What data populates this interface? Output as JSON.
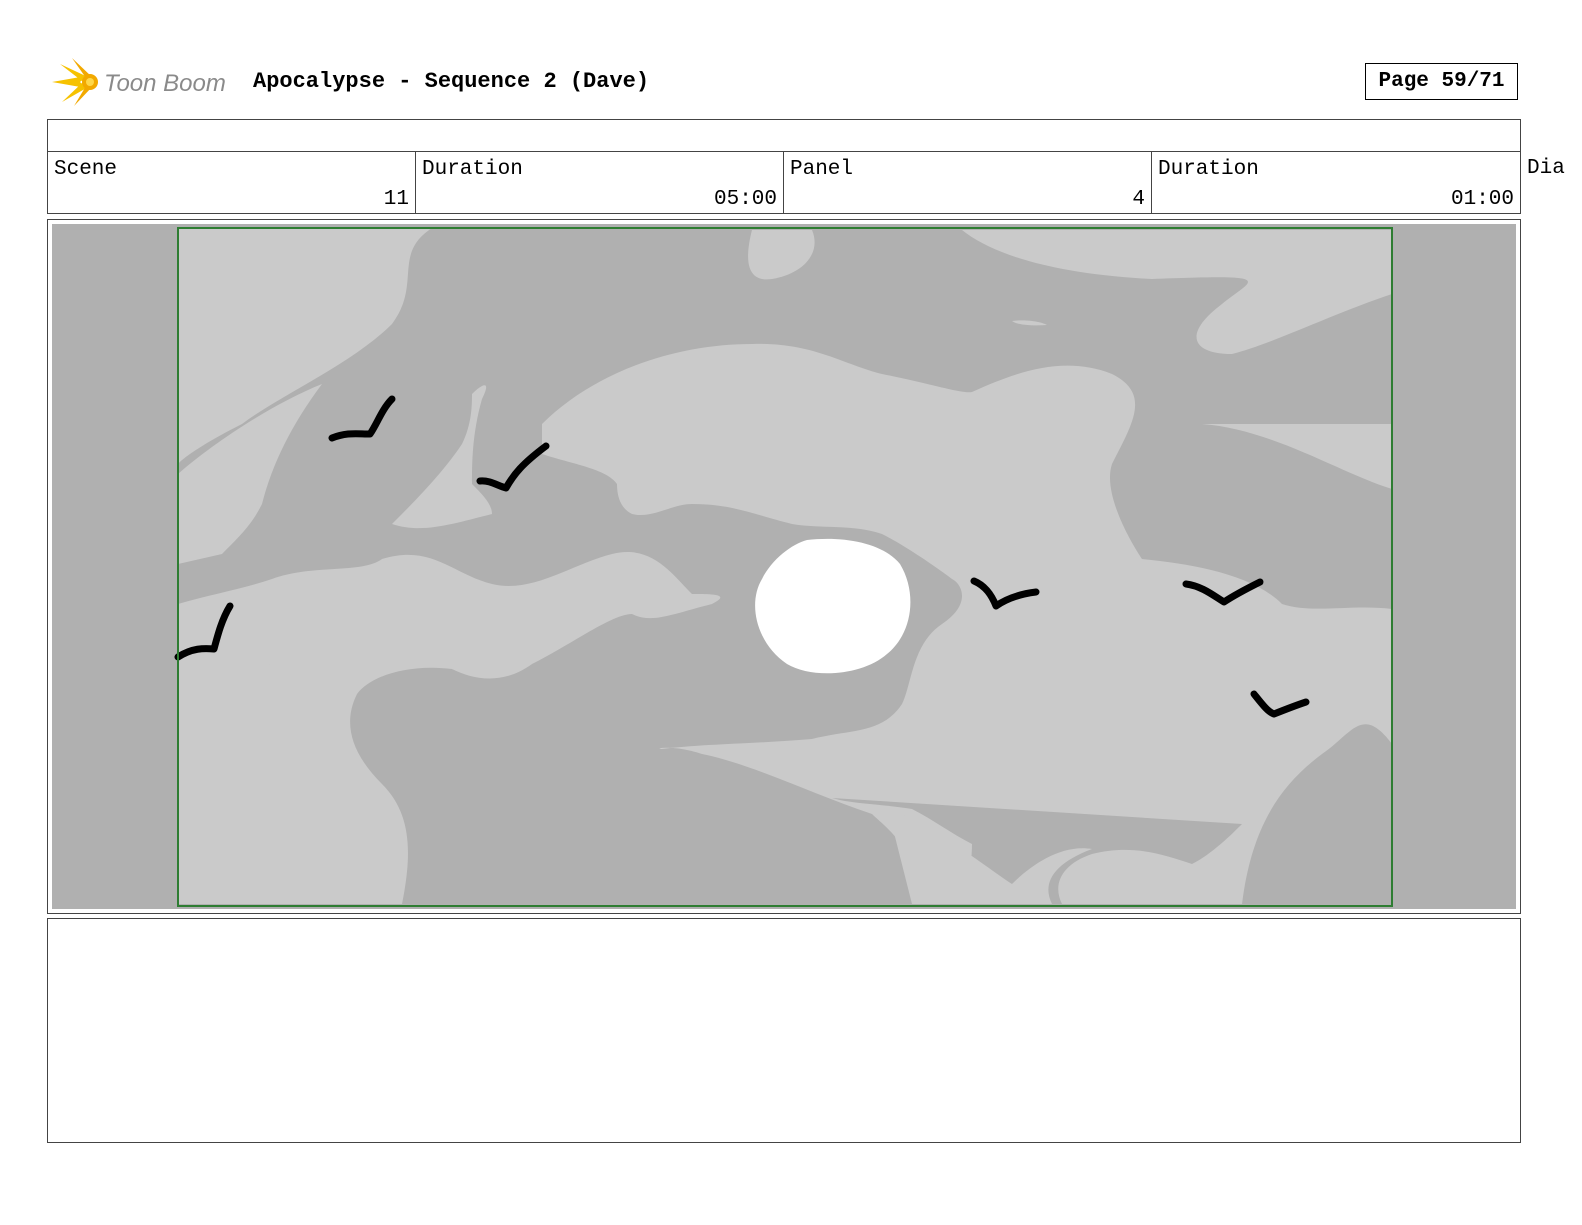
{
  "header": {
    "logo_text": "Toon Boom",
    "title": "Apocalypse - Sequence 2 (Dave)",
    "page": "Page 59/71"
  },
  "info": {
    "scene_label": "Scene",
    "scene_value": "11",
    "scene_duration_label": "Duration",
    "scene_duration_value": "05:00",
    "panel_label": "Panel",
    "panel_value": "4",
    "panel_duration_label": "Duration",
    "panel_duration_value": "01:00",
    "dialogue_label": "Dia"
  },
  "panel": {
    "frame_color": "#2e7d32",
    "sky_dark": "#b0b0b0",
    "cloud_light": "#cacaca",
    "sun_color": "#ffffff",
    "bird_color": "#000000"
  },
  "notes": {
    "text": ""
  }
}
